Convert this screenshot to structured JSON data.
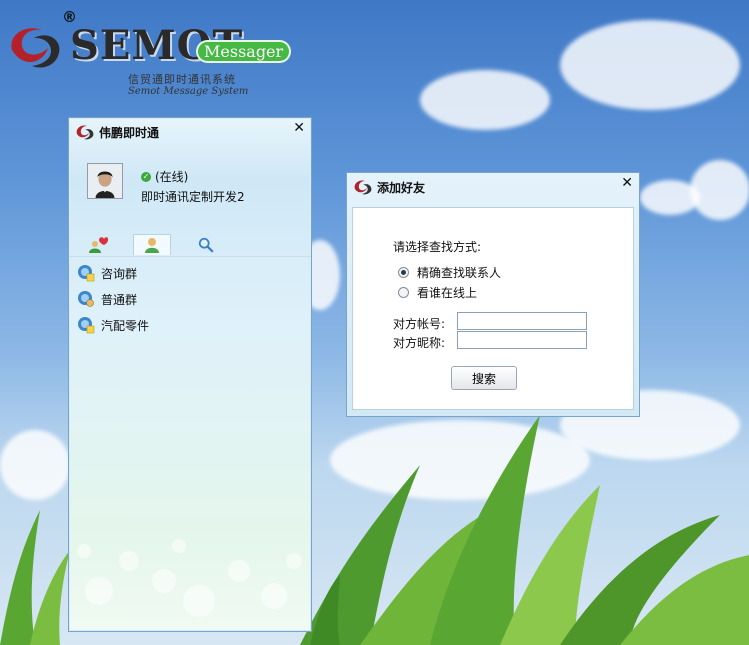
{
  "logo": {
    "registered": "®",
    "wordmark": "SEMOT",
    "badge": "Messager",
    "cn_name": "信贸通即时通讯系统",
    "en_name": "Semot Message System"
  },
  "main_window": {
    "title": "伟鹏即时通",
    "close": "✕",
    "status": "(在线)",
    "nickname": "即时通讯定制开发2",
    "tabs": [
      {
        "icon": "contacts-heart-icon"
      },
      {
        "icon": "user-icon"
      },
      {
        "icon": "search-icon"
      }
    ],
    "groups": [
      {
        "label": "咨询群"
      },
      {
        "label": "普通群"
      },
      {
        "label": "汽配零件"
      }
    ]
  },
  "add_friend": {
    "title": "添加好友",
    "close": "✕",
    "prompt": "请选择查找方式:",
    "options": [
      {
        "label": "精确查找联系人",
        "checked": true
      },
      {
        "label": "看谁在线上",
        "checked": false
      }
    ],
    "account_label": "对方帐号:",
    "account_value": "",
    "nickname_label": "对方昵称:",
    "nickname_value": "",
    "search_button": "搜索"
  },
  "colors": {
    "online": "#3ba83b",
    "badge": "#46b944",
    "window_border": "#7aa4c7"
  }
}
